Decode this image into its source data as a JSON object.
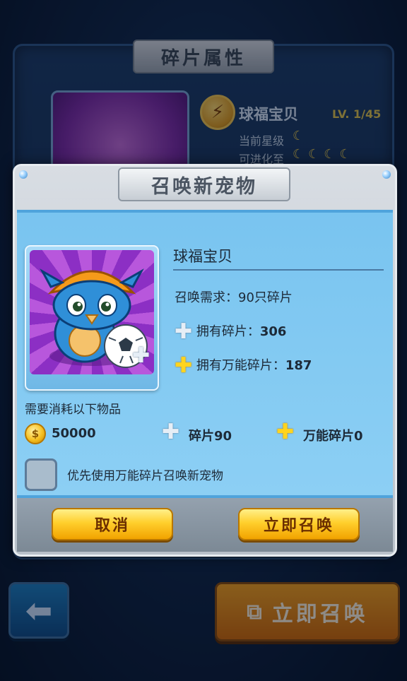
{
  "background": {
    "panel_title": "碎片属性",
    "pet_name": "球福宝贝",
    "level": "LV. 1/45",
    "current_star_label": "当前星级",
    "evolve_label": "可进化至",
    "back_icon": "arrow-left-icon",
    "summon_button": "立即召唤"
  },
  "modal": {
    "title": "召唤新宠物",
    "pet_name": "球福宝贝",
    "requirement": "召唤需求：90只碎片",
    "owned_fragments_label": "拥有碎片：",
    "owned_fragments_value": "306",
    "owned_universal_label": "拥有万能碎片：",
    "owned_universal_value": "187",
    "cost_title": "需要消耗以下物品",
    "cost_coins": "50000",
    "cost_fragments": "碎片90",
    "cost_universal": "万能碎片0",
    "checkbox_label": "优先使用万能碎片召唤新宠物",
    "checkbox_checked": false,
    "cancel_button": "取消",
    "confirm_button": "立即召唤"
  }
}
